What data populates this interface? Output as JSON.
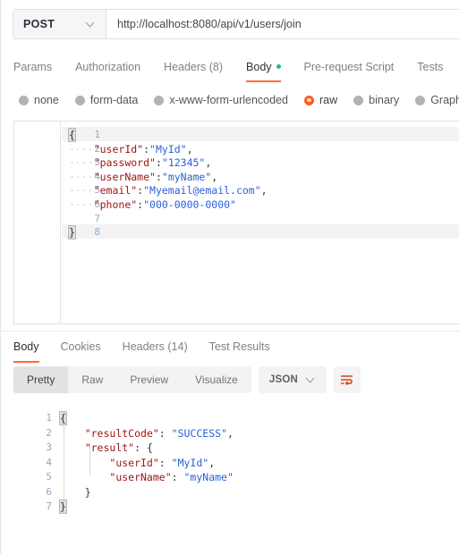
{
  "request": {
    "method": "POST",
    "method_icon": "chevron-down-icon",
    "url": "http://localhost:8080/api/v1/users/join",
    "url_placeholder": "Enter request URL",
    "tabs": [
      {
        "label": "Params",
        "active": false
      },
      {
        "label": "Authorization",
        "active": false
      },
      {
        "label": "Headers (8)",
        "active": false
      },
      {
        "label": "Body",
        "active": true,
        "has_dot": true
      },
      {
        "label": "Pre-request Script",
        "active": false
      },
      {
        "label": "Tests",
        "active": false
      }
    ],
    "body_types": [
      {
        "label": "none",
        "selected": false
      },
      {
        "label": "form-data",
        "selected": false
      },
      {
        "label": "x-www-form-urlencoded",
        "selected": false
      },
      {
        "label": "raw",
        "selected": true
      },
      {
        "label": "binary",
        "selected": false
      },
      {
        "label": "GraphQL",
        "selected": false
      }
    ],
    "editor": {
      "line_numbers": [
        "1",
        "2",
        "3",
        "4",
        "5",
        "6",
        "7",
        "8"
      ],
      "lines": [
        {
          "n": "1",
          "indent": "",
          "segments": [
            {
              "t": "{",
              "c": "brace"
            }
          ]
        },
        {
          "n": "2",
          "indent": "····",
          "segments": [
            {
              "t": "\"userId\"",
              "c": "k"
            },
            {
              "t": ":",
              "c": "p"
            },
            {
              "t": "\"MyId\"",
              "c": "v"
            },
            {
              "t": ",",
              "c": "p"
            }
          ]
        },
        {
          "n": "3",
          "indent": "····",
          "segments": [
            {
              "t": "\"password\"",
              "c": "k"
            },
            {
              "t": ":",
              "c": "p"
            },
            {
              "t": "\"12345\"",
              "c": "v"
            },
            {
              "t": ",",
              "c": "p"
            }
          ]
        },
        {
          "n": "4",
          "indent": "····",
          "segments": [
            {
              "t": "\"userName\"",
              "c": "k"
            },
            {
              "t": ":",
              "c": "p"
            },
            {
              "t": "\"myName\"",
              "c": "v"
            },
            {
              "t": ",",
              "c": "p"
            }
          ]
        },
        {
          "n": "5",
          "indent": "····",
          "segments": [
            {
              "t": "\"email\"",
              "c": "k"
            },
            {
              "t": ":",
              "c": "p"
            },
            {
              "t": "\"Myemail@email.com\"",
              "c": "v"
            },
            {
              "t": ",",
              "c": "p"
            }
          ]
        },
        {
          "n": "6",
          "indent": "····",
          "segments": [
            {
              "t": "\"phone\"",
              "c": "k"
            },
            {
              "t": ":",
              "c": "p"
            },
            {
              "t": "\"000-0000-0000\"",
              "c": "v"
            }
          ]
        },
        {
          "n": "7",
          "indent": "",
          "segments": []
        },
        {
          "n": "8",
          "indent": "",
          "segments": [
            {
              "t": "}",
              "c": "brace"
            }
          ]
        }
      ]
    }
  },
  "response": {
    "tabs": [
      {
        "label": "Body",
        "active": true
      },
      {
        "label": "Cookies",
        "active": false
      },
      {
        "label": "Headers (14)",
        "active": false
      },
      {
        "label": "Test Results",
        "active": false
      }
    ],
    "view_modes": [
      {
        "label": "Pretty",
        "active": true
      },
      {
        "label": "Raw",
        "active": false
      },
      {
        "label": "Preview",
        "active": false
      },
      {
        "label": "Visualize",
        "active": false
      }
    ],
    "format": {
      "label": "JSON",
      "icon": "chevron-down-icon"
    },
    "wrap_button": {
      "icon": "word-wrap-icon"
    },
    "editor": {
      "line_numbers": [
        "1",
        "2",
        "3",
        "4",
        "5",
        "6",
        "7"
      ],
      "lines": [
        {
          "n": "1",
          "pad": 0,
          "segments": [
            {
              "t": "{",
              "c": "brace"
            }
          ]
        },
        {
          "n": "2",
          "pad": 4,
          "segments": [
            {
              "t": "\"resultCode\"",
              "c": "k"
            },
            {
              "t": ": ",
              "c": "p"
            },
            {
              "t": "\"SUCCESS\"",
              "c": "v"
            },
            {
              "t": ",",
              "c": "p"
            }
          ]
        },
        {
          "n": "3",
          "pad": 4,
          "segments": [
            {
              "t": "\"result\"",
              "c": "k"
            },
            {
              "t": ": ",
              "c": "p"
            },
            {
              "t": "{",
              "c": "p"
            }
          ]
        },
        {
          "n": "4",
          "pad": 8,
          "segments": [
            {
              "t": "\"userId\"",
              "c": "k"
            },
            {
              "t": ": ",
              "c": "p"
            },
            {
              "t": "\"MyId\"",
              "c": "v"
            },
            {
              "t": ",",
              "c": "p"
            }
          ]
        },
        {
          "n": "5",
          "pad": 8,
          "segments": [
            {
              "t": "\"userName\"",
              "c": "k"
            },
            {
              "t": ": ",
              "c": "p"
            },
            {
              "t": "\"myName\"",
              "c": "v"
            }
          ]
        },
        {
          "n": "6",
          "pad": 4,
          "segments": [
            {
              "t": "}",
              "c": "p"
            }
          ]
        },
        {
          "n": "7",
          "pad": 0,
          "segments": [
            {
              "t": "}",
              "c": "brace"
            }
          ]
        }
      ]
    }
  },
  "colors": {
    "accent": "#ff6c37",
    "key": "#a31515",
    "value": "#2b5fd9",
    "success_dot": "#2bb673",
    "gutter_number": "#93a8c0"
  }
}
